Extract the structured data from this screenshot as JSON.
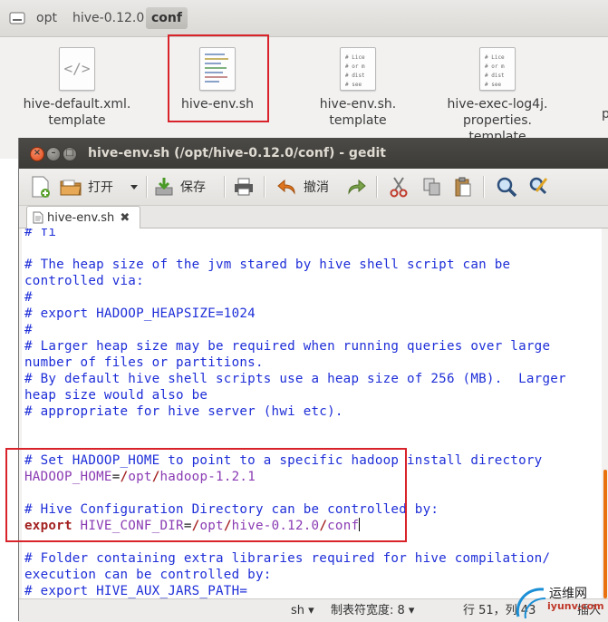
{
  "file_manager": {
    "breadcrumbs": [
      "opt",
      "hive-0.12.0",
      "conf"
    ],
    "files": [
      {
        "name_lines": [
          "hive-default.xml.",
          "template"
        ],
        "icon": "xml-file-icon"
      },
      {
        "name_lines": [
          "hive-env.sh"
        ],
        "icon": "text-file-icon"
      },
      {
        "name_lines": [
          "hive-env.sh.",
          "template"
        ],
        "icon": "license-file-icon"
      },
      {
        "name_lines": [
          "hive-exec-log4j.",
          "properties.",
          "template"
        ],
        "icon": "license-file-icon"
      }
    ],
    "thumb_text": [
      "# Lice",
      "# or m",
      "# dist",
      "# see"
    ],
    "cut_off_label": "p"
  },
  "gedit": {
    "title": "hive-env.sh (/opt/hive-0.12.0/conf) - gedit",
    "toolbar": {
      "open_label": "打开",
      "save_label": "保存",
      "undo_label": "撤消"
    },
    "tab": {
      "label": "hive-env.sh"
    },
    "lines": [
      {
        "segments": [
          {
            "t": "# fi",
            "c": "c"
          }
        ]
      },
      {
        "segments": []
      },
      {
        "segments": [
          {
            "t": "# The heap size of the jvm stared by hive shell script can be",
            "c": "c"
          }
        ]
      },
      {
        "segments": [
          {
            "t": "controlled via:",
            "c": "c"
          }
        ]
      },
      {
        "segments": [
          {
            "t": "#",
            "c": "c"
          }
        ]
      },
      {
        "segments": [
          {
            "t": "# export HADOOP_HEAPSIZE=1024",
            "c": "c"
          }
        ]
      },
      {
        "segments": [
          {
            "t": "#",
            "c": "c"
          }
        ]
      },
      {
        "segments": [
          {
            "t": "# Larger heap size may be required when running queries over large",
            "c": "c"
          }
        ]
      },
      {
        "segments": [
          {
            "t": "number of files or partitions.",
            "c": "c"
          }
        ]
      },
      {
        "segments": [
          {
            "t": "# By default hive shell scripts use a heap size of 256 (MB).  Larger",
            "c": "c"
          }
        ]
      },
      {
        "segments": [
          {
            "t": "heap size would also be",
            "c": "c"
          }
        ]
      },
      {
        "segments": [
          {
            "t": "# appropriate for hive server (hwi etc).",
            "c": "c"
          }
        ]
      },
      {
        "segments": []
      },
      {
        "segments": []
      },
      {
        "segments": [
          {
            "t": "# Set HADOOP_HOME to point to a specific hadoop install directory",
            "c": "c"
          }
        ]
      },
      {
        "segments": [
          {
            "t": "HADOOP_HOME",
            "c": "v"
          },
          {
            "t": "=",
            "c": "t"
          },
          {
            "t": "/",
            "c": "k"
          },
          {
            "t": "opt",
            "c": "v"
          },
          {
            "t": "/",
            "c": "k"
          },
          {
            "t": "hadoop-1.2.1",
            "c": "v"
          }
        ]
      },
      {
        "segments": []
      },
      {
        "segments": [
          {
            "t": "# Hive Configuration Directory can be controlled by:",
            "c": "c"
          }
        ]
      },
      {
        "segments": [
          {
            "t": "export",
            "c": "k"
          },
          {
            "t": " HIVE_CONF_DIR",
            "c": "v"
          },
          {
            "t": "=",
            "c": "t"
          },
          {
            "t": "/",
            "c": "k"
          },
          {
            "t": "opt",
            "c": "v"
          },
          {
            "t": "/",
            "c": "k"
          },
          {
            "t": "hive-0.12.0",
            "c": "v"
          },
          {
            "t": "/",
            "c": "k"
          },
          {
            "t": "conf",
            "c": "v"
          }
        ],
        "cursor": true
      },
      {
        "segments": []
      },
      {
        "segments": [
          {
            "t": "# Folder containing extra libraries required for hive compilation/",
            "c": "c"
          }
        ]
      },
      {
        "segments": [
          {
            "t": "execution can be controlled by:",
            "c": "c"
          }
        ]
      },
      {
        "segments": [
          {
            "t": "# export HIVE_AUX_JARS_PATH=",
            "c": "c"
          }
        ]
      }
    ],
    "status": {
      "language": "sh",
      "tab_width": "制表符宽度: 8",
      "position": "行 51，列 43",
      "mode": "插入"
    }
  },
  "watermark": {
    "line1": "运维网",
    "line2": "iyunv.com"
  },
  "colors": {
    "comment": "#1e2ed8",
    "variable": "#8a3bb3",
    "keyword": "#a32020",
    "highlight": "#d8232a"
  }
}
